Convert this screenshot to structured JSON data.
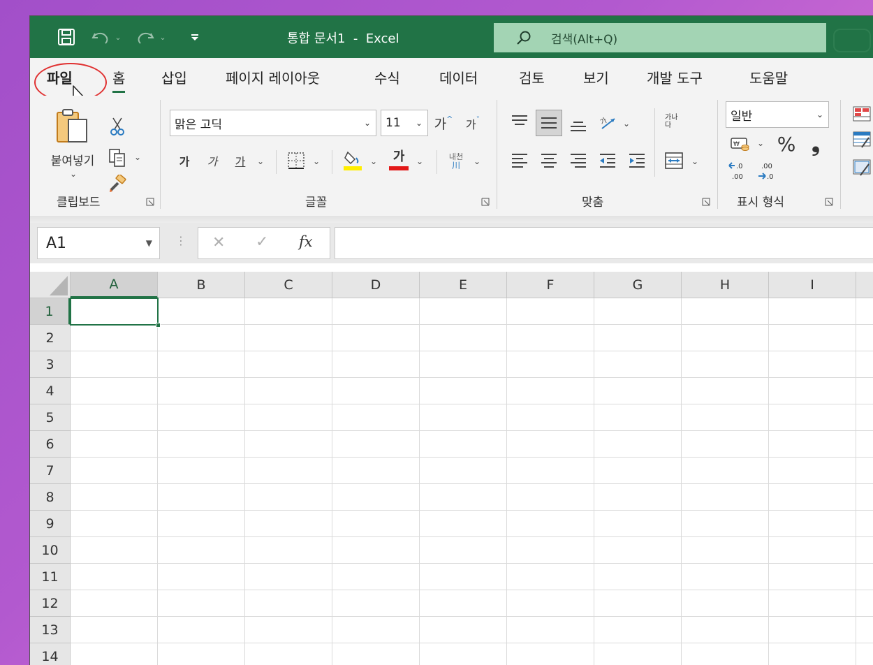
{
  "window": {
    "title": "통합 문서1  -  Excel",
    "accent": "#217346"
  },
  "search": {
    "label": "검색(Alt+Q)"
  },
  "tabs": [
    {
      "label": "파일"
    },
    {
      "label": "홈"
    },
    {
      "label": "삽입"
    },
    {
      "label": "페이지 레이아웃"
    },
    {
      "label": "수식"
    },
    {
      "label": "데이터"
    },
    {
      "label": "검토"
    },
    {
      "label": "보기"
    },
    {
      "label": "개발 도구"
    },
    {
      "label": "도움말"
    }
  ],
  "ribbon": {
    "clipboard": {
      "paste_label": "붙여넣기",
      "group_label": "클립보드"
    },
    "font": {
      "font_name": "맑은 고딕",
      "font_size": "11",
      "grow_label": "가",
      "shrink_label": "가",
      "bold_label": "가",
      "italic_label": "가",
      "underline_label": "가",
      "font_color_label": "가",
      "phonetic_label": "내천",
      "group_label": "글꼴"
    },
    "alignment": {
      "wrap_label": "가나다",
      "group_label": "맞춤"
    },
    "number": {
      "format": "일반",
      "percent_label": "%",
      "comma_label": "❟",
      "inc_decimal_label": ".0 .00",
      "dec_decimal_label": ".00 .0",
      "group_label": "표시 형식"
    }
  },
  "formula_bar": {
    "name_box": "A1",
    "cancel_label": "✕",
    "enter_label": "✓",
    "fx_label": "fx",
    "value": ""
  },
  "grid": {
    "columns": [
      "A",
      "B",
      "C",
      "D",
      "E",
      "F",
      "G",
      "H",
      "I"
    ],
    "rows": [
      "1",
      "2",
      "3",
      "4",
      "5",
      "6",
      "7",
      "8",
      "9",
      "10",
      "11",
      "12",
      "13",
      "14"
    ],
    "active_cell": "A1"
  },
  "annotation": {
    "highlight_color": "#e03030"
  }
}
